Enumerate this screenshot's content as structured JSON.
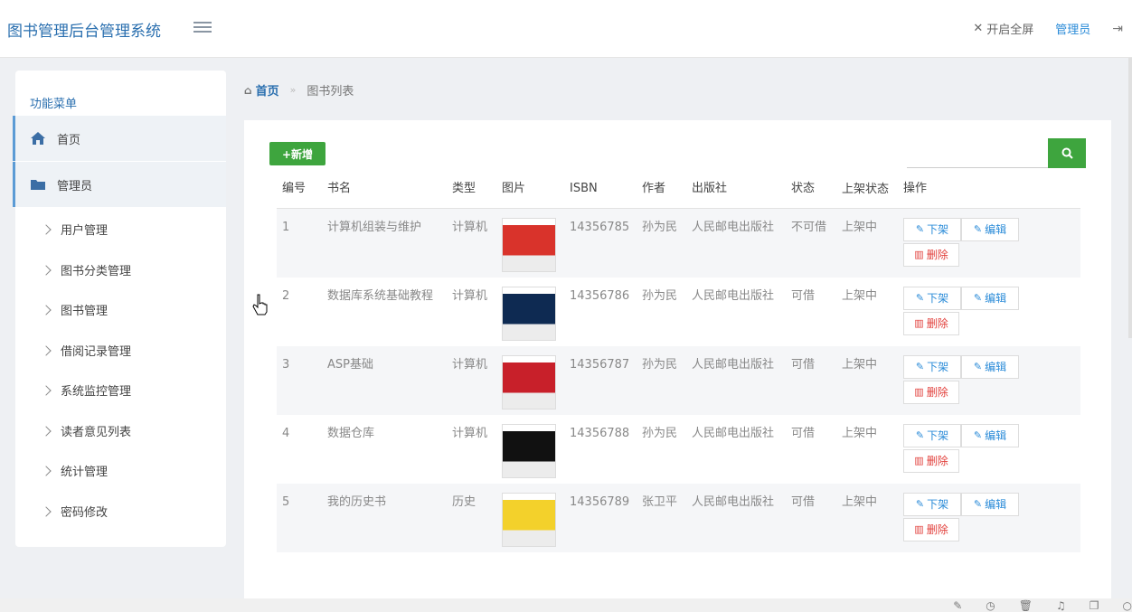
{
  "app": {
    "title": "图书管理后台管理系统"
  },
  "header": {
    "fullscreen_label": "开启全屏",
    "user_label": "管理员"
  },
  "sidebar": {
    "title": "功能菜单",
    "top_items": [
      {
        "label": "首页",
        "icon": "home-icon"
      },
      {
        "label": "管理员",
        "icon": "folder-icon"
      }
    ],
    "sub_items": [
      {
        "label": "用户管理"
      },
      {
        "label": "图书分类管理"
      },
      {
        "label": "图书管理"
      },
      {
        "label": "借阅记录管理"
      },
      {
        "label": "系统监控管理"
      },
      {
        "label": "读者意见列表"
      },
      {
        "label": "统计管理"
      },
      {
        "label": "密码修改"
      }
    ]
  },
  "breadcrumb": {
    "home": "首页",
    "current": "图书列表"
  },
  "toolbar": {
    "add_label": "+新增",
    "search_placeholder": ""
  },
  "table": {
    "headers": [
      "编号",
      "书名",
      "类型",
      "图片",
      "ISBN",
      "作者",
      "出版社",
      "状态",
      "上架状态",
      "操作"
    ],
    "action_labels": {
      "off_shelf": "下架",
      "edit": "编辑",
      "delete": "删除"
    },
    "rows": [
      {
        "id": "1",
        "name": "计算机组装与维护",
        "type": "计算机",
        "cover_color": "#d9332b",
        "isbn": "14356785",
        "author": "孙为民",
        "publisher": "人民邮电出版社",
        "status": "不可借",
        "shelf": "上架中"
      },
      {
        "id": "2",
        "name": "数据库系统基础教程",
        "type": "计算机",
        "cover_color": "#0e2a52",
        "isbn": "14356786",
        "author": "孙为民",
        "publisher": "人民邮电出版社",
        "status": "可借",
        "shelf": "上架中"
      },
      {
        "id": "3",
        "name": "ASP基础",
        "type": "计算机",
        "cover_color": "#c8202a",
        "isbn": "14356787",
        "author": "孙为民",
        "publisher": "人民邮电出版社",
        "status": "可借",
        "shelf": "上架中"
      },
      {
        "id": "4",
        "name": "数据仓库",
        "type": "计算机",
        "cover_color": "#111111",
        "isbn": "14356788",
        "author": "孙为民",
        "publisher": "人民邮电出版社",
        "status": "可借",
        "shelf": "上架中"
      },
      {
        "id": "5",
        "name": "我的历史书",
        "type": "历史",
        "cover_color": "#f3d12b",
        "isbn": "14356789",
        "author": "张卫平",
        "publisher": "人民邮电出版社",
        "status": "可借",
        "shelf": "上架中"
      }
    ]
  },
  "colors": {
    "accent": "#2a6faf",
    "success": "#3ea53e",
    "danger": "#e2403c",
    "link": "#2a8bd8"
  }
}
